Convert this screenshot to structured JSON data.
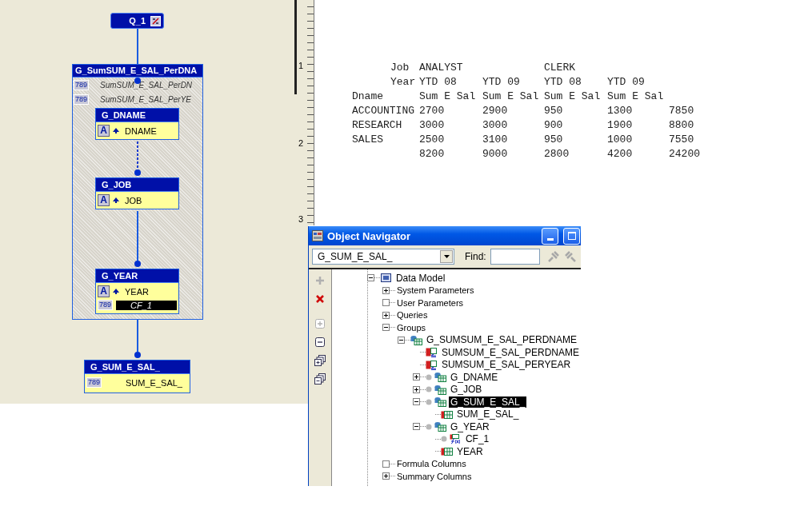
{
  "diagram": {
    "query": {
      "name": "Q_1"
    },
    "outer_group": {
      "title": "G_SumSUM_E_SAL_PerDNA",
      "columns": [
        {
          "icon_text": "789",
          "name": "SumSUM_E_SAL_PerDN"
        },
        {
          "icon_text": "789",
          "name": "SumSUM_E_SAL_PerYE"
        }
      ]
    },
    "groups": [
      {
        "name": "G_DNAME",
        "columns": [
          {
            "kind": "break",
            "icon_text": "A",
            "name": "DNAME",
            "selected": false
          }
        ]
      },
      {
        "name": "G_JOB",
        "columns": [
          {
            "kind": "break",
            "icon_text": "A",
            "name": "JOB",
            "selected": false
          }
        ]
      },
      {
        "name": "G_YEAR",
        "columns": [
          {
            "kind": "break",
            "icon_text": "A",
            "name": "YEAR",
            "selected": false
          },
          {
            "kind": "number",
            "icon_text": "789",
            "name": "CF_1",
            "selected": true
          }
        ]
      }
    ],
    "bottom_group": {
      "name": "G_SUM_E_SAL_",
      "columns": [
        {
          "kind": "number",
          "icon_text": "789",
          "name": "SUM_E_SAL_",
          "selected": false
        }
      ]
    }
  },
  "ruler": {
    "labels": [
      "1",
      "2",
      "3"
    ]
  },
  "report": {
    "rows": [
      {
        "label": "Job",
        "cells": [
          "ANALYST",
          null,
          "CLERK"
        ]
      },
      {
        "label": "Year",
        "cells": [
          "YTD 08",
          "YTD 09",
          "YTD 08",
          "YTD 09"
        ]
      },
      {
        "dname": "Dname",
        "cells": [
          "Sum E Sal",
          "Sum E Sal",
          "Sum E Sal",
          "Sum E Sal"
        ]
      },
      {
        "dname": "ACCOUNTING",
        "cells": [
          "2700",
          "2900",
          "950",
          "1300",
          "7850"
        ]
      },
      {
        "dname": "RESEARCH",
        "cells": [
          "3000",
          "3000",
          "900",
          "1900",
          "8800"
        ]
      },
      {
        "dname": "SALES",
        "cells": [
          "2500",
          "3100",
          "950",
          "1000",
          "7550"
        ]
      },
      {
        "cells": [
          "8200",
          "9000",
          "2800",
          "4200",
          "24200"
        ]
      }
    ]
  },
  "navigator": {
    "title": "Object Navigator",
    "dropdown": {
      "value": "G_SUM_E_SAL_"
    },
    "find_label": "Find:",
    "toolbar": [
      {
        "kind": "add",
        "disabled": true
      },
      {
        "kind": "delete",
        "disabled": false
      },
      {
        "kind": "expand",
        "disabled": true
      },
      {
        "kind": "collapse",
        "disabled": false
      },
      {
        "kind": "expand-all",
        "disabled": false
      },
      {
        "kind": "collapse-all",
        "disabled": false
      }
    ],
    "tree": [
      {
        "kind": "model",
        "label": "Data Model",
        "has_children": true,
        "expanded": true,
        "selected": false,
        "children": [
          {
            "kind": "folder",
            "label": "System Parameters",
            "has_children": true,
            "expanded": false,
            "selected": false
          },
          {
            "kind": "folder",
            "label": "User Parameters",
            "has_children": false,
            "selected": false
          },
          {
            "kind": "folder",
            "label": "Queries",
            "has_children": true,
            "expanded": false,
            "selected": false
          },
          {
            "kind": "folder",
            "label": "Groups",
            "has_children": true,
            "expanded": true,
            "selected": false,
            "children": [
              {
                "kind": "group",
                "label": "G_SUMSUM_E_SAL_PERDNAME",
                "has_children": true,
                "expanded": true,
                "selected": false,
                "children": [
                  {
                    "kind": "summary",
                    "label": "SUMSUM_E_SAL_PERDNAME",
                    "selected": false
                  },
                  {
                    "kind": "summary",
                    "label": "SUMSUM_E_SAL_PERYEAR",
                    "selected": false
                  },
                  {
                    "kind": "subgroup",
                    "label": "G_DNAME",
                    "has_children": true,
                    "expanded": false,
                    "selected": false
                  },
                  {
                    "kind": "subgroup",
                    "label": "G_JOB",
                    "has_children": true,
                    "expanded": false,
                    "selected": false
                  },
                  {
                    "kind": "subgroup",
                    "label": "G_SUM_E_SAL_",
                    "has_children": true,
                    "expanded": true,
                    "selected": true,
                    "children": [
                      {
                        "kind": "column",
                        "label": "SUM_E_SAL_",
                        "selected": false
                      }
                    ]
                  },
                  {
                    "kind": "subgroup",
                    "label": "G_YEAR",
                    "has_children": true,
                    "expanded": true,
                    "selected": false,
                    "children": [
                      {
                        "kind": "formula",
                        "label": "CF_1",
                        "selected": false
                      },
                      {
                        "kind": "column",
                        "label": "YEAR",
                        "selected": false
                      }
                    ]
                  }
                ]
              }
            ]
          },
          {
            "kind": "folder",
            "label": "Formula Columns",
            "has_children": false,
            "selected": false
          },
          {
            "kind": "folder",
            "label": "Summary Columns",
            "has_children": true,
            "expanded": false,
            "selected": false
          }
        ]
      }
    ]
  }
}
